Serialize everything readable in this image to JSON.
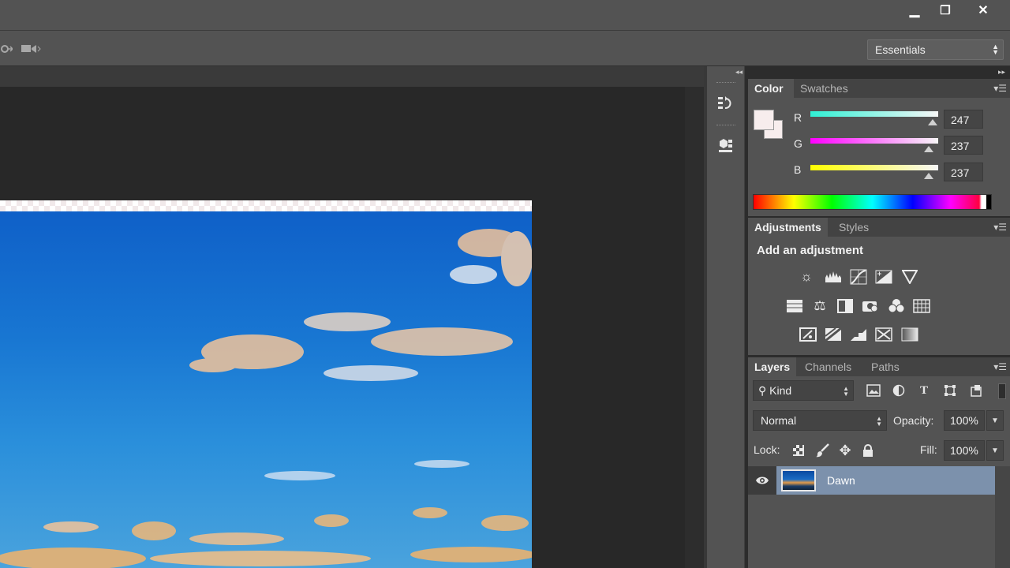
{
  "window": {
    "minimize_glyph": "▁",
    "restore_glyph": "❐",
    "close_glyph": "✕"
  },
  "options_bar": {
    "icons": [
      "rotate-3d-icon",
      "video-camera-icon"
    ],
    "workspace": {
      "value": "Essentials"
    }
  },
  "document": {
    "image": "sky-with-clouds-photo"
  },
  "panel_strip": {
    "icons": [
      "history-icon",
      "3d-icon"
    ]
  },
  "color_panel": {
    "tabs": [
      {
        "label": "Color",
        "active": true
      },
      {
        "label": "Swatches",
        "active": false
      }
    ],
    "foreground_color": "#f7eded",
    "channels": [
      {
        "label": "R",
        "value": "247",
        "gradient": [
          "#2ff0d4",
          "#f7f7f7"
        ]
      },
      {
        "label": "G",
        "value": "237",
        "gradient": [
          "#ff00ff",
          "#f7f7f7"
        ]
      },
      {
        "label": "B",
        "value": "237",
        "gradient": [
          "#ffff00",
          "#f7f7f7"
        ]
      }
    ]
  },
  "adjustments_panel": {
    "tabs": [
      {
        "label": "Adjustments",
        "active": true
      },
      {
        "label": "Styles",
        "active": false
      }
    ],
    "heading": "Add an adjustment",
    "icons": [
      [
        "brightness-contrast-icon",
        "levels-icon",
        "curves-icon",
        "exposure-icon",
        "vibrance-icon"
      ],
      [
        "hue-saturation-icon",
        "color-balance-icon",
        "black-white-icon",
        "photo-filter-icon",
        "channel-mixer-icon",
        "color-lookup-icon"
      ],
      [
        "invert-icon",
        "posterize-icon",
        "threshold-icon",
        "selective-color-icon",
        "gradient-map-icon"
      ]
    ]
  },
  "layers_panel": {
    "tabs": [
      {
        "label": "Layers",
        "active": true
      },
      {
        "label": "Channels",
        "active": false
      },
      {
        "label": "Paths",
        "active": false
      }
    ],
    "filter": {
      "value": "Kind",
      "icons": [
        "pixel-layer-filter-icon",
        "adjustment-layer-filter-icon",
        "type-layer-filter-icon",
        "shape-layer-filter-icon",
        "smart-object-filter-icon"
      ]
    },
    "blend_mode": "Normal",
    "opacity_label": "Opacity:",
    "opacity": "100%",
    "lock_label": "Lock:",
    "lock_icons": [
      "lock-transparent-pixels-icon",
      "lock-image-pixels-icon",
      "lock-position-icon",
      "lock-all-icon"
    ],
    "fill_label": "Fill:",
    "fill": "100%",
    "layers": [
      {
        "name": "Dawn",
        "visible": true,
        "selected": true
      }
    ]
  }
}
